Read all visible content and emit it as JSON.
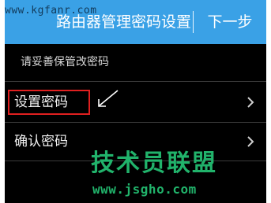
{
  "watermarks": {
    "top_url": "www.kgfanr.com",
    "brand": "技术员联盟",
    "brand_url": "www.jsgho.com"
  },
  "header": {
    "title": "路由器管理密码设置",
    "next_label": "下一步"
  },
  "hint": "请妥善保管改密码",
  "menu": {
    "items": [
      {
        "label": "设置密码",
        "icon": "chevron-right-icon",
        "highlighted": true
      },
      {
        "label": "确认密码",
        "icon": "chevron-right-icon",
        "highlighted": false
      }
    ]
  },
  "colors": {
    "header_bg": "#3aa1e6",
    "screen_bg": "#000000",
    "highlight": "#e02020",
    "watermark_green": "#21b36b"
  }
}
